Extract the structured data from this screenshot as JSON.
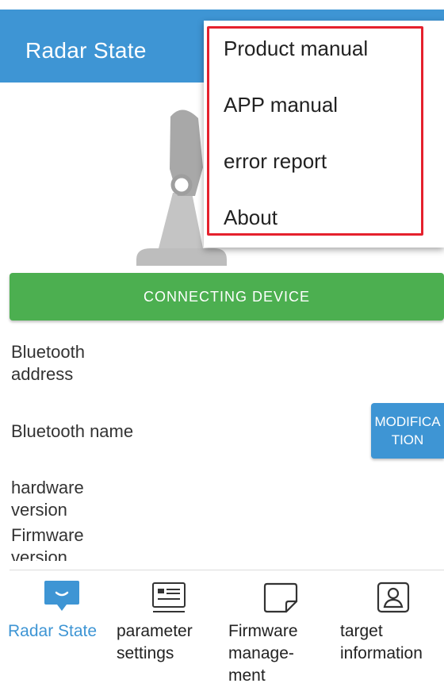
{
  "header": {
    "title": "Radar State"
  },
  "menu": {
    "items": [
      {
        "label": "Product manual"
      },
      {
        "label": "APP manual"
      },
      {
        "label": "error report"
      },
      {
        "label": "About"
      }
    ]
  },
  "main": {
    "connect_button": "CONNECTING DEVICE",
    "bluetooth_address_label": "Bluetooth address",
    "bluetooth_name_label": "Bluetooth name",
    "modify_button": "MODIFICATION",
    "hardware_version_label": "hardware version",
    "firmware_version_label": "Firmware version"
  },
  "bottom_nav": {
    "items": [
      {
        "label": "Radar State",
        "icon": "radar-state-icon",
        "active": true
      },
      {
        "label": "parameter settings",
        "icon": "parameter-settings-icon",
        "active": false
      },
      {
        "label": "Firmware manage-ment",
        "icon": "firmware-management-icon",
        "active": false
      },
      {
        "label": "target information",
        "icon": "target-information-icon",
        "active": false
      }
    ]
  },
  "colors": {
    "header": "#3e95d4",
    "connect_button": "#4caf50",
    "accent": "#3e95d4",
    "highlight": "#e5212d"
  }
}
